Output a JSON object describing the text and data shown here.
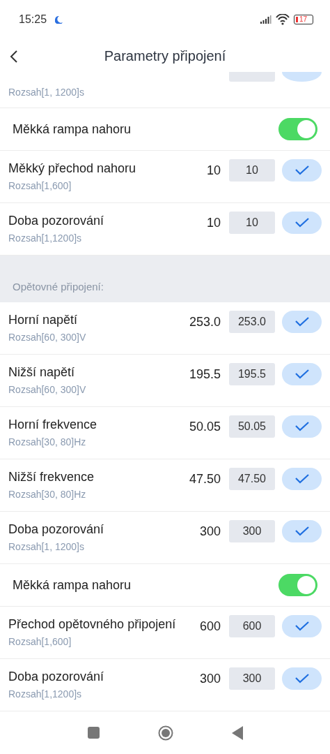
{
  "status_bar": {
    "time": "15:25",
    "battery": "17"
  },
  "header": {
    "title": "Parametry připojení"
  },
  "items": [
    {
      "kind": "partial",
      "range": "Rozsah[1, 1200]s"
    },
    {
      "kind": "toggle",
      "label": "Měkká rampa nahoru",
      "on": true
    },
    {
      "kind": "param",
      "label": "Měkký přechod nahoru",
      "value": "10",
      "input": "10",
      "range": "Rozsah[1,600]"
    },
    {
      "kind": "param",
      "label": "Doba pozorování",
      "value": "10",
      "input": "10",
      "range": "Rozsah[1,1200]s"
    },
    {
      "kind": "section",
      "label": "Opětovné připojení:"
    },
    {
      "kind": "param",
      "label": "Horní napětí",
      "value": "253.0",
      "input": "253.0",
      "range": "Rozsah[60, 300]V"
    },
    {
      "kind": "param",
      "label": "Nižší napětí",
      "value": "195.5",
      "input": "195.5",
      "range": "Rozsah[60, 300]V"
    },
    {
      "kind": "param",
      "label": "Horní frekvence",
      "value": "50.05",
      "input": "50.05",
      "range": "Rozsah[30, 80]Hz"
    },
    {
      "kind": "param",
      "label": "Nižší frekvence",
      "value": "47.50",
      "input": "47.50",
      "range": "Rozsah[30, 80]Hz"
    },
    {
      "kind": "param",
      "label": "Doba pozorování",
      "value": "300",
      "input": "300",
      "range": "Rozsah[1, 1200]s"
    },
    {
      "kind": "toggle",
      "label": "Měkká rampa nahoru",
      "on": true
    },
    {
      "kind": "param",
      "label": "Přechod opětovného připojení",
      "value": "600",
      "input": "600",
      "range": "Rozsah[1,600]"
    },
    {
      "kind": "param",
      "label": "Doba pozorování",
      "value": "300",
      "input": "300",
      "range": "Rozsah[1,1200]s"
    }
  ]
}
